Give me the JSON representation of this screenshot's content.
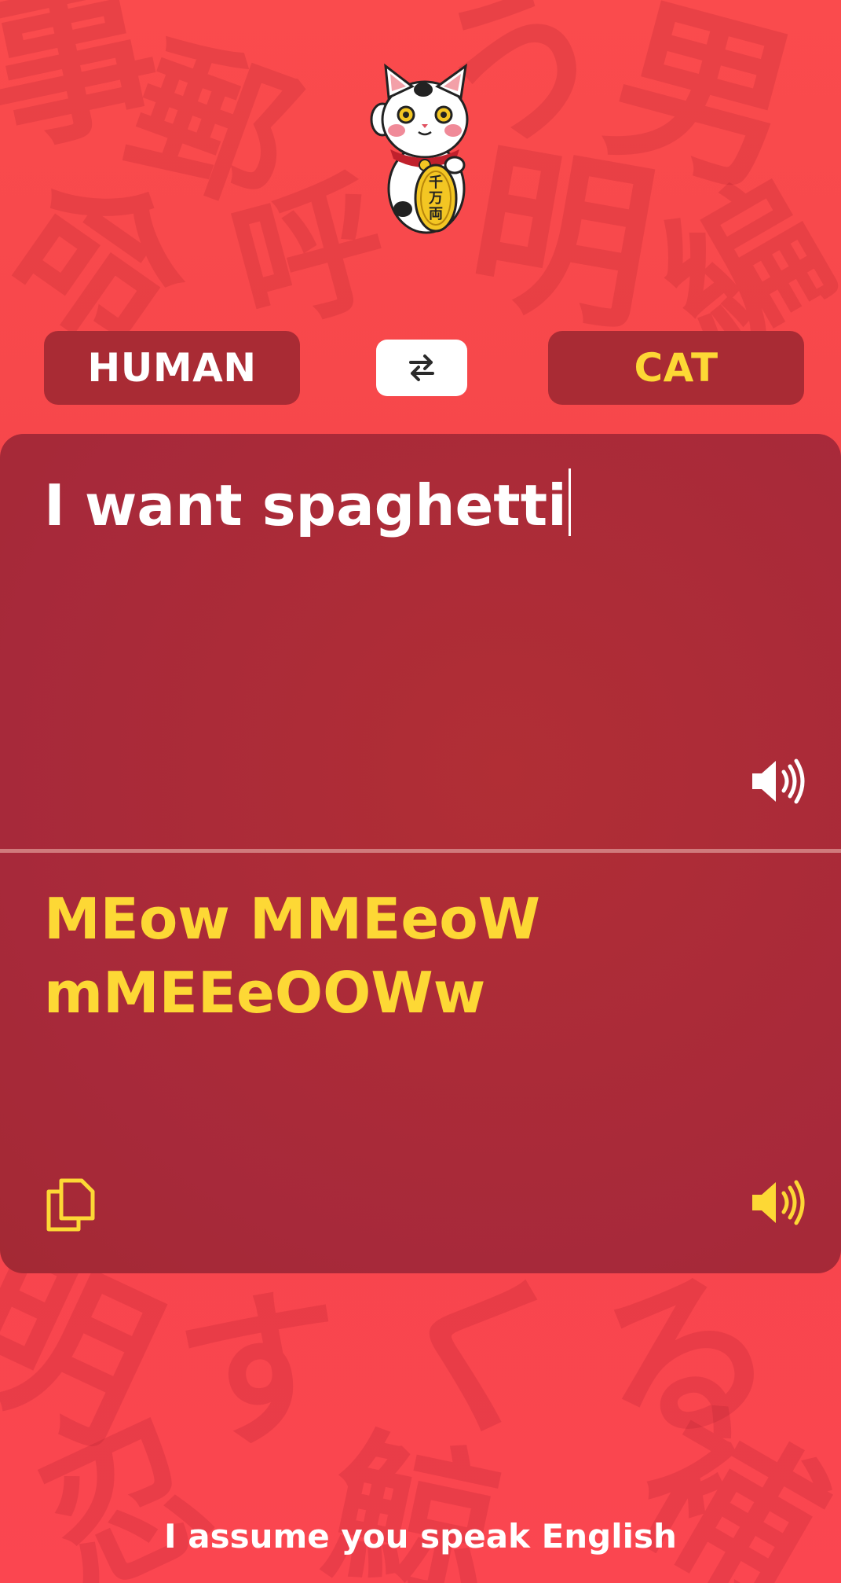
{
  "app": {
    "mascot_icon": "maneki-neko-lucky-cat",
    "mascot_coin_text": "千万両"
  },
  "languages": {
    "source": "HUMAN",
    "target": "CAT",
    "swap_icon": "swap-arrows-icon"
  },
  "input": {
    "value": "I want spaghetti",
    "speaker_icon": "speaker-icon"
  },
  "output": {
    "value": "MEow MMEeoW mMEEeOOWw",
    "copy_icon": "copy-icon",
    "speaker_icon": "speaker-icon"
  },
  "footer": {
    "note": "I assume you speak English"
  },
  "colors": {
    "background": "#f74a4d",
    "panel": "#a92b34",
    "accent_yellow": "#fdd835",
    "text_white": "#ffffff"
  }
}
